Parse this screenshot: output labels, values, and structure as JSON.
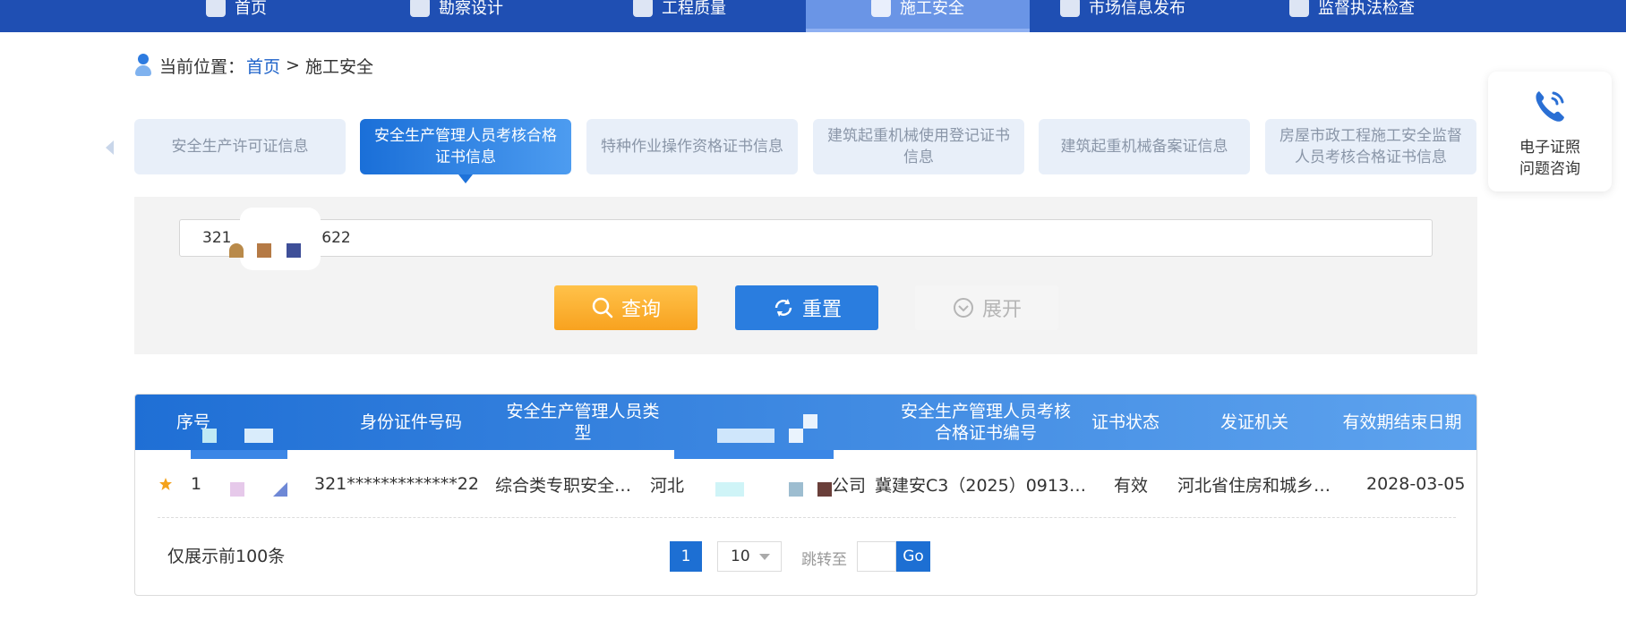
{
  "topnav": {
    "items": [
      {
        "label": "首页"
      },
      {
        "label": "勘察设计"
      },
      {
        "label": "工程质量"
      },
      {
        "label": "施工安全"
      },
      {
        "label": "市场信息发布"
      },
      {
        "label": "监督执法检查"
      }
    ]
  },
  "breadcrumb": {
    "prefix": "当前位置：",
    "home": "首页",
    "separator": ">",
    "current": "施工安全"
  },
  "tabs": [
    {
      "label": "安全生产许可证信息"
    },
    {
      "label": "安全生产管理人员考核合格证书信息"
    },
    {
      "label": "特种作业操作资格证书信息"
    },
    {
      "label": "建筑起重机械使用登记证书信息"
    },
    {
      "label": "建筑起重机械备案证信息"
    },
    {
      "label": "房屋市政工程施工安全监督人员考核合格证书信息"
    }
  ],
  "help": {
    "line1": "电子证照",
    "line2": "问题咨询"
  },
  "search": {
    "value_start": "321",
    "value_end": "2622"
  },
  "buttons": {
    "query": "查询",
    "reset": "重置",
    "expand": "展开"
  },
  "table": {
    "headers": {
      "seq": "序号",
      "id": "身份证件号码",
      "type": "安全生产管理人员类型",
      "cert_no": "安全生产管理人员考核合格证书编号",
      "status": "证书状态",
      "issuer": "发证机关",
      "expiry": "有效期结束日期"
    },
    "rows": [
      {
        "seq": "1",
        "id": "321*************22",
        "type": "综合类专职安全…",
        "company_start": "河北",
        "company_end": "公司",
        "cert_no": "冀建安C3（2025）0913…",
        "status": "有效",
        "issuer": "河北省住房和城乡…",
        "expiry": "2028-03-05"
      }
    ]
  },
  "pager": {
    "note": "仅展示前100条",
    "current_page": "1",
    "page_size": "10",
    "jump_label": "跳转至",
    "go": "Go"
  },
  "colors": {
    "nav": "#1f4fb3",
    "accent": "#1d6fd3",
    "query_button": "#f8a21f"
  }
}
